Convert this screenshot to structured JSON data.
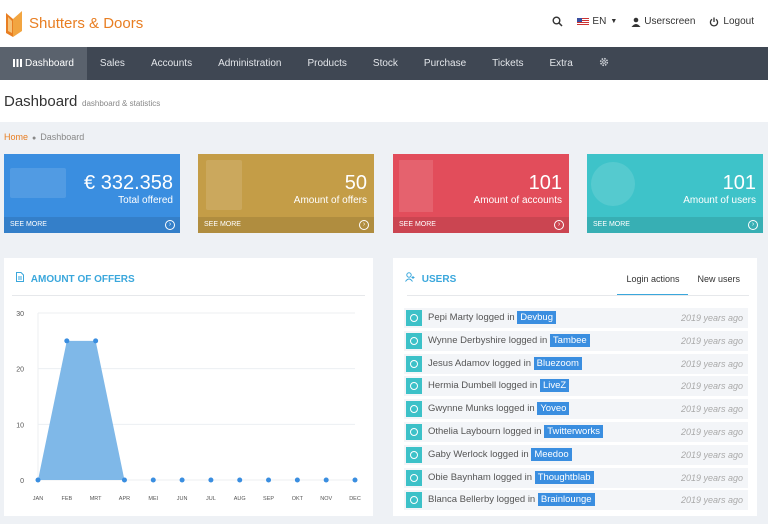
{
  "brand": {
    "name": "Shutters & Doors"
  },
  "topbar": {
    "language": "EN",
    "userscreen": "Userscreen",
    "logout": "Logout"
  },
  "nav": {
    "items": [
      "Dashboard",
      "Sales",
      "Accounts",
      "Administration",
      "Products",
      "Stock",
      "Purchase",
      "Tickets",
      "Extra"
    ],
    "active": "Dashboard"
  },
  "page": {
    "title": "Dashboard",
    "subtitle": "dashboard & statistics"
  },
  "breadcrumb": {
    "home": "Home",
    "current": "Dashboard"
  },
  "stats": [
    {
      "value": "€ 332.358",
      "label": "Total offered",
      "more": "SEE MORE",
      "color": "#3a8ee0"
    },
    {
      "value": "50",
      "label": "Amount of offers",
      "more": "SEE MORE",
      "color": "#c49d47"
    },
    {
      "value": "101",
      "label": "Amount of accounts",
      "more": "SEE MORE",
      "color": "#e24d5b"
    },
    {
      "value": "101",
      "label": "Amount of users",
      "more": "SEE MORE",
      "color": "#3ec3c9"
    }
  ],
  "offers_panel": {
    "title": "AMOUNT OF OFFERS"
  },
  "chart_data": {
    "type": "area",
    "categories": [
      "JAN",
      "FEB",
      "MRT",
      "APR",
      "MEI",
      "JUN",
      "JUL",
      "AUG",
      "SEP",
      "OKT",
      "NOV",
      "DEC"
    ],
    "values": [
      0,
      25,
      25,
      0,
      0,
      0,
      0,
      0,
      0,
      0,
      0,
      0
    ],
    "yticks": [
      0,
      10,
      20,
      30
    ],
    "ylim": [
      0,
      30
    ],
    "color": "#7fb8e8"
  },
  "users_panel": {
    "title": "USERS",
    "tabs": [
      "Login actions",
      "New users"
    ],
    "rows": [
      {
        "name": "Pepi Marty",
        "action": "logged in",
        "company": "Devbug",
        "time": "2019 years ago"
      },
      {
        "name": "Wynne Derbyshire",
        "action": "logged in",
        "company": "Tambee",
        "time": "2019 years ago"
      },
      {
        "name": "Jesus Adamov",
        "action": "logged in",
        "company": "Bluezoom",
        "time": "2019 years ago"
      },
      {
        "name": "Hermia Dumbell",
        "action": "logged in",
        "company": "LiveZ",
        "time": "2019 years ago"
      },
      {
        "name": "Gwynne Munks",
        "action": "logged in",
        "company": "Yoveo",
        "time": "2019 years ago"
      },
      {
        "name": "Othelia Laybourn",
        "action": "logged in",
        "company": "Twitterworks",
        "time": "2019 years ago"
      },
      {
        "name": "Gaby Werlock",
        "action": "logged in",
        "company": "Meedoo",
        "time": "2019 years ago"
      },
      {
        "name": "Obie Baynham",
        "action": "logged in",
        "company": "Thoughtblab",
        "time": "2019 years ago"
      },
      {
        "name": "Blanca Bellerby",
        "action": "logged in",
        "company": "Brainlounge",
        "time": "2019 years ago"
      }
    ]
  }
}
